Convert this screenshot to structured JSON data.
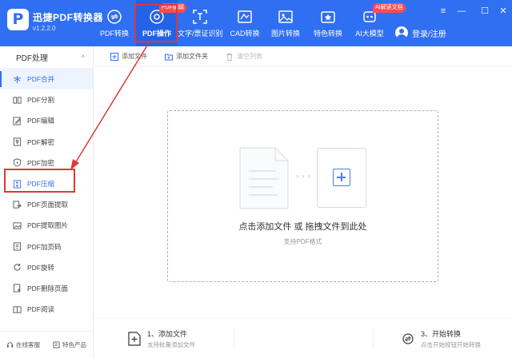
{
  "app": {
    "logo_letter": "P",
    "name": "迅捷PDF转换器",
    "version": "v1.2.2.0"
  },
  "nav": {
    "items": [
      {
        "label": "PDF转换",
        "icon": "convert-icon"
      },
      {
        "label": "PDF操作",
        "icon": "pdf-operate-icon"
      },
      {
        "label": "文字/票证识别",
        "icon": "ocr-icon"
      },
      {
        "label": "CAD转换",
        "icon": "cad-icon"
      },
      {
        "label": "图片转换",
        "icon": "image-icon"
      },
      {
        "label": "特色转换",
        "icon": "feature-icon"
      },
      {
        "label": "AI大模型",
        "icon": "ai-icon"
      }
    ],
    "badges": {
      "pdf_edit": "PDF编辑",
      "ai_reader": "AI解读文档"
    }
  },
  "user": {
    "login": "登录/注册"
  },
  "window": {
    "menu": "≡",
    "minimize": "—",
    "maximize": "☐",
    "close": "✕"
  },
  "sidebar": {
    "section_title": "PDF处理",
    "chevron": "^",
    "items": [
      {
        "label": "PDF合并",
        "icon": "merge-icon"
      },
      {
        "label": "PDF分割",
        "icon": "split-icon"
      },
      {
        "label": "PDF编辑",
        "icon": "edit-icon"
      },
      {
        "label": "PDF解密",
        "icon": "unlock-icon"
      },
      {
        "label": "PDF加密",
        "icon": "lock-shield-icon"
      },
      {
        "label": "PDF压缩",
        "icon": "compress-icon"
      },
      {
        "label": "PDF页面提取",
        "icon": "page-extract-icon"
      },
      {
        "label": "PDF提取图片",
        "icon": "image-extract-icon"
      },
      {
        "label": "PDF加页码",
        "icon": "page-number-icon"
      },
      {
        "label": "PDF旋转",
        "icon": "rotate-icon"
      },
      {
        "label": "PDF删除页面",
        "icon": "delete-page-icon"
      },
      {
        "label": "PDF阅读",
        "icon": "read-icon"
      }
    ],
    "footer": {
      "service": "在线客服",
      "products": "特色产品"
    }
  },
  "toolbar": {
    "add_file": "添加文件",
    "add_folder": "添加文件夹",
    "clear_list": "清空列表"
  },
  "dropzone": {
    "arrows": "› › ›",
    "title": "点击添加文件 或 拖拽文件到此处",
    "subtitle": "支持PDF格式"
  },
  "steps": {
    "step1_title": "1、添加文件",
    "step1_sub": "支持批量添加文件",
    "step3_title": "3、开始转换",
    "step3_sub": "点击开始按钮开始转换"
  },
  "colors": {
    "header_blue": "#2f6ff2",
    "accent": "#2f6ff2",
    "annotation_red": "#d93a3a",
    "badge_red": "#ff4d4f"
  }
}
